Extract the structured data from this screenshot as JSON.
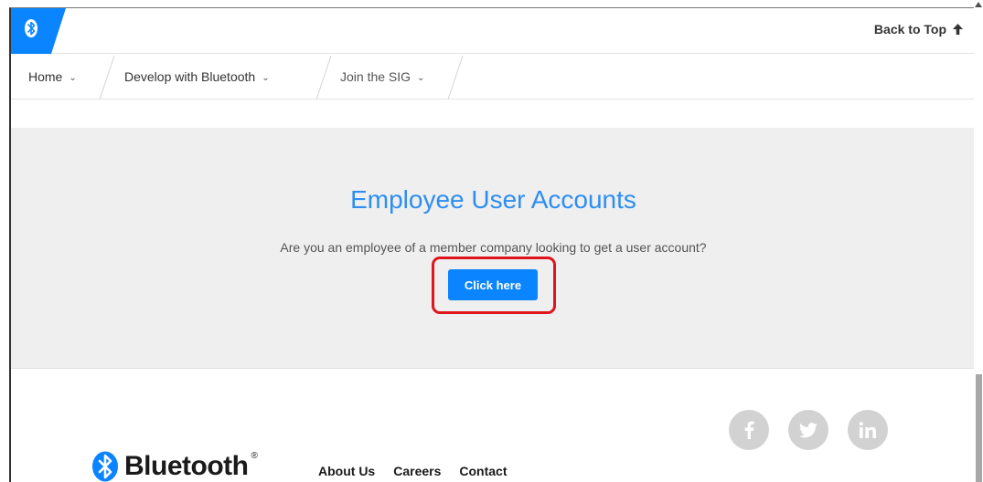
{
  "colors": {
    "brand_blue": "#0a84ff",
    "title_blue": "#2e8ef0",
    "band_bg": "#efefef",
    "highlight_red": "#e0141c",
    "social_gray": "#d2d2d2"
  },
  "header": {
    "badge_icon": "bluetooth-icon",
    "back_to_top": "Back to Top",
    "back_to_top_icon": "arrow-up-icon"
  },
  "nav": {
    "items": [
      {
        "label": "Home",
        "icon": "chevron-down-icon"
      },
      {
        "label": "Develop with Bluetooth",
        "icon": "chevron-down-icon"
      },
      {
        "label": "Join the SIG",
        "icon": "chevron-down-icon"
      }
    ]
  },
  "main": {
    "title": "Employee User Accounts",
    "text": "Are you an employee of a member company looking to get a user account?",
    "cta_label": "Click here"
  },
  "footer": {
    "logo_text": "Bluetooth",
    "logo_mark": "®",
    "links": [
      "About Us",
      "Careers",
      "Contact"
    ],
    "social": [
      "facebook-icon",
      "twitter-icon",
      "linkedin-icon"
    ]
  }
}
